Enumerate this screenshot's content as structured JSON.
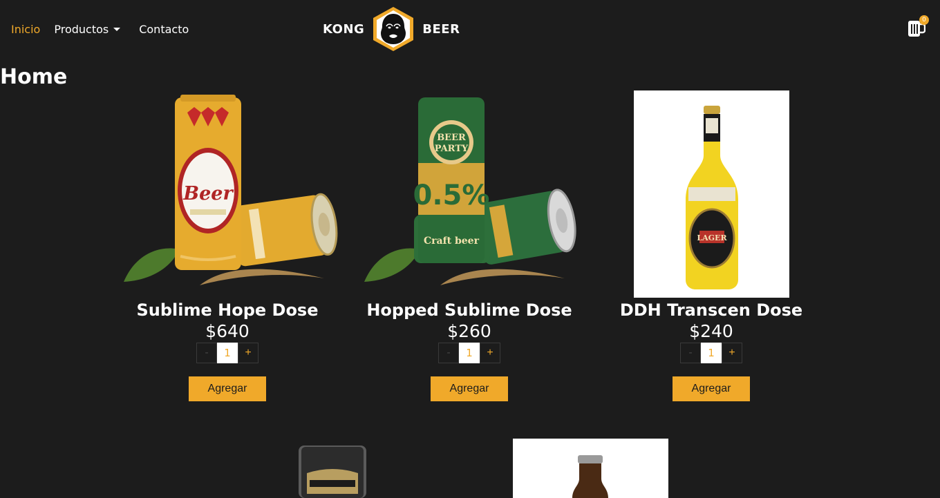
{
  "nav": {
    "links": [
      {
        "label": "Inicio"
      },
      {
        "label": "Productos"
      },
      {
        "label": "Contacto"
      }
    ],
    "brand_left": "KONG",
    "brand_right": "BEER",
    "cart_count": "0"
  },
  "page": {
    "title": "Home"
  },
  "products": [
    {
      "name": "Sublime Hope Dose",
      "price": "$640",
      "qty": "1",
      "minus": "-",
      "plus": "+",
      "add_label": "Agregar"
    },
    {
      "name": "Hopped Sublime Dose",
      "price": "$260",
      "qty": "1",
      "minus": "-",
      "plus": "+",
      "add_label": "Agregar"
    },
    {
      "name": "DDH Transcen Dose",
      "price": "$240",
      "qty": "1",
      "minus": "-",
      "plus": "+",
      "add_label": "Agregar"
    }
  ],
  "colors": {
    "accent": "#f0a92a",
    "background": "#1c1c1c"
  }
}
